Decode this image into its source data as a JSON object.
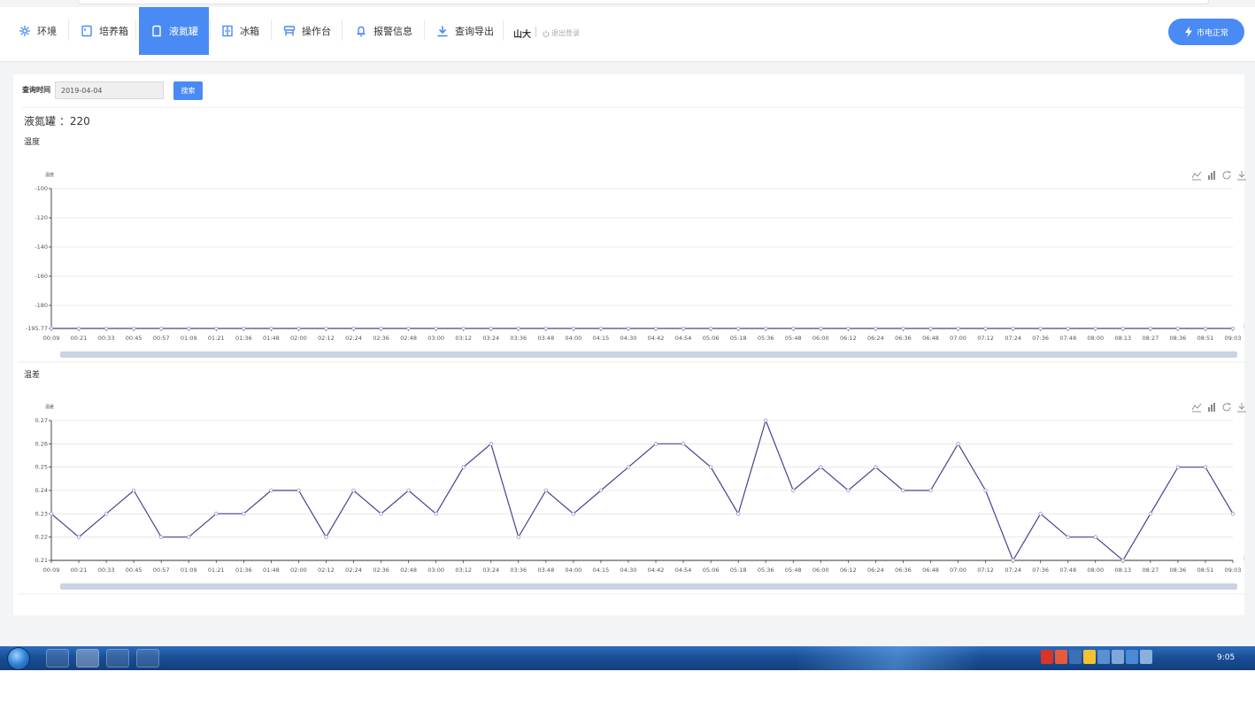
{
  "nav": {
    "items": [
      {
        "key": "env",
        "label": "环境",
        "icon": "snowflake-icon"
      },
      {
        "key": "incubator",
        "label": "培养箱",
        "icon": "incubator-icon"
      },
      {
        "key": "ln2",
        "label": "液氮罐",
        "icon": "tank-icon"
      },
      {
        "key": "fridge",
        "label": "冰箱",
        "icon": "fridge-icon"
      },
      {
        "key": "bench",
        "label": "操作台",
        "icon": "bench-icon"
      },
      {
        "key": "alarm",
        "label": "报警信息",
        "icon": "bell-icon"
      },
      {
        "key": "export",
        "label": "查询导出",
        "icon": "download-icon"
      }
    ],
    "active": "液氮罐",
    "user": "山大",
    "logout": "退出登录",
    "power_status": "市电正常",
    "accent": "#4a8af4"
  },
  "query": {
    "label": "查询时间",
    "date": "2019-04-04",
    "search_label": "搜索"
  },
  "device": {
    "title": "液氮罐 ：220"
  },
  "sections": {
    "temp": "温度",
    "diff": "温差"
  },
  "chart_data": [
    {
      "type": "line",
      "title": "温度",
      "ylabel": "温度",
      "ylim": [
        -195.77,
        -100
      ],
      "yticks": [
        "-100",
        "-120",
        "-140",
        "-160",
        "-180",
        "-195.77"
      ],
      "x": [
        "00:09",
        "00:21",
        "00:33",
        "00:45",
        "00:57",
        "01:09",
        "01:21",
        "01:36",
        "01:48",
        "02:00",
        "02:12",
        "02:24",
        "02:36",
        "02:48",
        "03:00",
        "03:12",
        "03:24",
        "03:36",
        "03:48",
        "04:00",
        "04:15",
        "04:30",
        "04:42",
        "04:54",
        "05:06",
        "05:18",
        "05:36",
        "05:48",
        "06:00",
        "06:12",
        "06:24",
        "06:36",
        "06:48",
        "07:00",
        "07:12",
        "07:24",
        "07:36",
        "07:48",
        "08:00",
        "08:13",
        "08:27",
        "08:36",
        "08:51",
        "09:03"
      ],
      "series": [
        {
          "color": "#4b3f8f",
          "values": [
            -195.77,
            -195.77,
            -195.77,
            -195.77,
            -195.77,
            -195.77,
            -195.77,
            -195.77,
            -195.77,
            -195.77,
            -195.77,
            -195.77,
            -195.77,
            -195.77,
            -195.77,
            -195.77,
            -195.77,
            -195.77,
            -195.77,
            -195.77,
            -195.77,
            -195.77,
            -195.77,
            -195.77,
            -195.77,
            -195.77,
            -195.77,
            -195.77,
            -195.77,
            -195.77,
            -195.77,
            -195.77,
            -195.77,
            -195.77,
            -195.77,
            -195.77,
            -195.77,
            -195.77,
            -195.77,
            -195.77,
            -195.77,
            -195.77,
            -195.77,
            -195.77
          ]
        }
      ],
      "grid": true
    },
    {
      "type": "line",
      "title": "温差",
      "ylabel": "温差",
      "ylim": [
        0.21,
        0.27
      ],
      "yticks": [
        "0.27",
        "0.26",
        "0.25",
        "0.24",
        "0.23",
        "0.22",
        "0.21"
      ],
      "x": [
        "00:09",
        "00:21",
        "00:33",
        "00:45",
        "00:57",
        "01:09",
        "01:21",
        "01:36",
        "01:48",
        "02:00",
        "02:12",
        "02:24",
        "02:36",
        "02:48",
        "03:00",
        "03:12",
        "03:24",
        "03:36",
        "03:48",
        "04:00",
        "04:15",
        "04:30",
        "04:42",
        "04:54",
        "05:06",
        "05:18",
        "05:36",
        "05:48",
        "06:00",
        "06:12",
        "06:24",
        "06:36",
        "06:48",
        "07:00",
        "07:12",
        "07:24",
        "07:36",
        "07:48",
        "08:00",
        "08:13",
        "08:27",
        "08:36",
        "08:51",
        "09:03"
      ],
      "series": [
        {
          "color": "#4b3f8f",
          "values": [
            0.23,
            0.22,
            0.23,
            0.24,
            0.22,
            0.22,
            0.23,
            0.23,
            0.24,
            0.24,
            0.22,
            0.24,
            0.23,
            0.24,
            0.23,
            0.25,
            0.26,
            0.22,
            0.24,
            0.23,
            0.24,
            0.25,
            0.26,
            0.26,
            0.25,
            0.23,
            0.27,
            0.24,
            0.25,
            0.24,
            0.25,
            0.24,
            0.24,
            0.26,
            0.24,
            0.21,
            0.23,
            0.22,
            0.22,
            0.21,
            0.23,
            0.25,
            0.25,
            0.23
          ]
        }
      ],
      "grid": true
    }
  ],
  "taskbar": {
    "clock": "9:05"
  }
}
